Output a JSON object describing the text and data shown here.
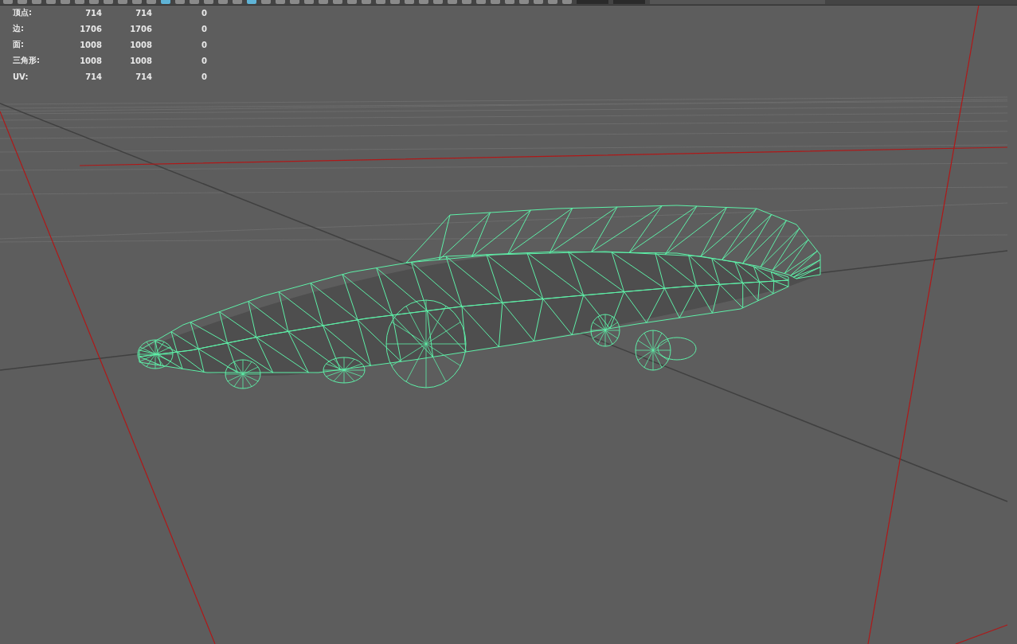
{
  "stats": [
    {
      "label": "顶点:",
      "values": [
        "714",
        "714",
        "0"
      ]
    },
    {
      "label": "边:",
      "values": [
        "1706",
        "1706",
        "0"
      ]
    },
    {
      "label": "面:",
      "values": [
        "1008",
        "1008",
        "0"
      ]
    },
    {
      "label": "三角形:",
      "values": [
        "1008",
        "1008",
        "0"
      ]
    },
    {
      "label": "UV:",
      "values": [
        "714",
        "714",
        "0"
      ]
    }
  ]
}
